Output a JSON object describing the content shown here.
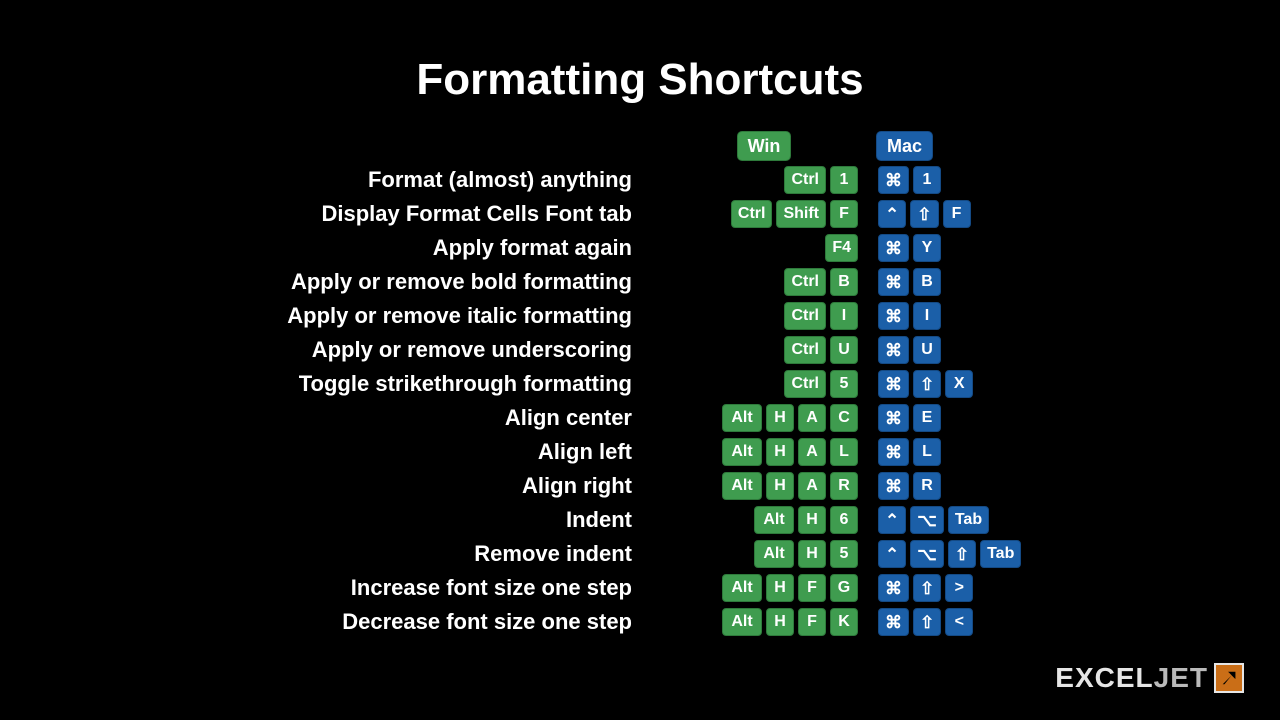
{
  "title": "Formatting Shortcuts",
  "platforms": {
    "win": "Win",
    "mac": "Mac"
  },
  "glyphs": {
    "cmd": "⌘",
    "ctrl_mac": "⌃",
    "shift_mac": "⇧",
    "option": "⌥"
  },
  "rows": [
    {
      "desc": "Format (almost) anything",
      "win": [
        {
          "t": "Ctrl",
          "w": "wide"
        },
        {
          "t": "1"
        }
      ],
      "mac": [
        {
          "g": "cmd"
        },
        {
          "t": "1"
        }
      ]
    },
    {
      "desc": "Display Format Cells Font tab",
      "win": [
        {
          "t": "Ctrl",
          "w": "wide"
        },
        {
          "t": "Shift",
          "w": "xwide"
        },
        {
          "t": "F"
        }
      ],
      "mac": [
        {
          "g": "ctrl_mac"
        },
        {
          "g": "shift_mac"
        },
        {
          "t": "F"
        }
      ]
    },
    {
      "desc": "Apply format again",
      "win": [
        {
          "t": "F4"
        }
      ],
      "mac": [
        {
          "g": "cmd"
        },
        {
          "t": "Y"
        }
      ]
    },
    {
      "desc": "Apply or remove bold formatting",
      "win": [
        {
          "t": "Ctrl",
          "w": "wide"
        },
        {
          "t": "B"
        }
      ],
      "mac": [
        {
          "g": "cmd"
        },
        {
          "t": "B"
        }
      ]
    },
    {
      "desc": "Apply or remove italic formatting",
      "win": [
        {
          "t": "Ctrl",
          "w": "wide"
        },
        {
          "t": "I"
        }
      ],
      "mac": [
        {
          "g": "cmd"
        },
        {
          "t": "I"
        }
      ]
    },
    {
      "desc": "Apply or remove underscoring",
      "win": [
        {
          "t": "Ctrl",
          "w": "wide"
        },
        {
          "t": "U"
        }
      ],
      "mac": [
        {
          "g": "cmd"
        },
        {
          "t": "U"
        }
      ]
    },
    {
      "desc": "Toggle strikethrough formatting",
      "win": [
        {
          "t": "Ctrl",
          "w": "wide"
        },
        {
          "t": "5"
        }
      ],
      "mac": [
        {
          "g": "cmd"
        },
        {
          "g": "shift_mac"
        },
        {
          "t": "X"
        }
      ]
    },
    {
      "desc": "Align center",
      "win": [
        {
          "t": "Alt",
          "w": "wide"
        },
        {
          "t": "H"
        },
        {
          "t": "A"
        },
        {
          "t": "C"
        }
      ],
      "mac": [
        {
          "g": "cmd"
        },
        {
          "t": "E"
        }
      ]
    },
    {
      "desc": "Align left",
      "win": [
        {
          "t": "Alt",
          "w": "wide"
        },
        {
          "t": "H"
        },
        {
          "t": "A"
        },
        {
          "t": "L"
        }
      ],
      "mac": [
        {
          "g": "cmd"
        },
        {
          "t": "L"
        }
      ]
    },
    {
      "desc": "Align right",
      "win": [
        {
          "t": "Alt",
          "w": "wide"
        },
        {
          "t": "H"
        },
        {
          "t": "A"
        },
        {
          "t": "R"
        }
      ],
      "mac": [
        {
          "g": "cmd"
        },
        {
          "t": "R"
        }
      ]
    },
    {
      "desc": "Indent",
      "win": [
        {
          "t": "Alt",
          "w": "wide"
        },
        {
          "t": "H"
        },
        {
          "t": "6"
        }
      ],
      "mac": [
        {
          "g": "ctrl_mac"
        },
        {
          "g": "option"
        },
        {
          "t": "Tab",
          "w": "wide"
        }
      ]
    },
    {
      "desc": "Remove indent",
      "win": [
        {
          "t": "Alt",
          "w": "wide"
        },
        {
          "t": "H"
        },
        {
          "t": "5"
        }
      ],
      "mac": [
        {
          "g": "ctrl_mac"
        },
        {
          "g": "option"
        },
        {
          "g": "shift_mac"
        },
        {
          "t": "Tab",
          "w": "wide"
        }
      ]
    },
    {
      "desc": "Increase font size one step",
      "win": [
        {
          "t": "Alt",
          "w": "wide"
        },
        {
          "t": "H"
        },
        {
          "t": "F"
        },
        {
          "t": "G"
        }
      ],
      "mac": [
        {
          "g": "cmd"
        },
        {
          "g": "shift_mac"
        },
        {
          "t": ">"
        }
      ]
    },
    {
      "desc": "Decrease font size one step",
      "win": [
        {
          "t": "Alt",
          "w": "wide"
        },
        {
          "t": "H"
        },
        {
          "t": "F"
        },
        {
          "t": "K"
        }
      ],
      "mac": [
        {
          "g": "cmd"
        },
        {
          "g": "shift_mac"
        },
        {
          "t": "<"
        }
      ]
    }
  ],
  "logo": {
    "a": "EXCEL",
    "b": "JET"
  }
}
